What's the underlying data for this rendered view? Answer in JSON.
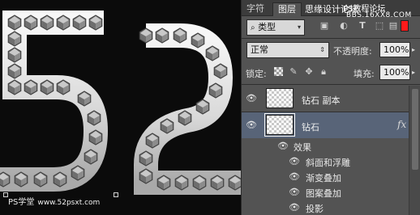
{
  "canvas": {
    "watermark": "PS学堂",
    "watermark_site": "www.52psxt.com"
  },
  "panel": {
    "tabs": [
      "字符",
      "图层"
    ],
    "watermark_top_1": "思缘设计论坛",
    "watermark_top_2": "PS教程论坛",
    "watermark_top_3": "BBS.16XX8.COM",
    "filter": {
      "kind_label": "类型",
      "search_icon": "search-icon"
    },
    "blend": {
      "mode": "正常",
      "opacity_label": "不透明度:",
      "opacity_value": "100%"
    },
    "lock": {
      "label": "锁定:",
      "fill_label": "填充:",
      "fill_value": "100%"
    },
    "layers": [
      {
        "name": "钻石 副本",
        "selected": false,
        "fx": false
      },
      {
        "name": "钻石",
        "selected": true,
        "fx": true,
        "fx_label": "fx"
      }
    ],
    "effects_label": "效果",
    "effects": [
      "斜面和浮雕",
      "渐变叠加",
      "图案叠加",
      "投影"
    ]
  }
}
